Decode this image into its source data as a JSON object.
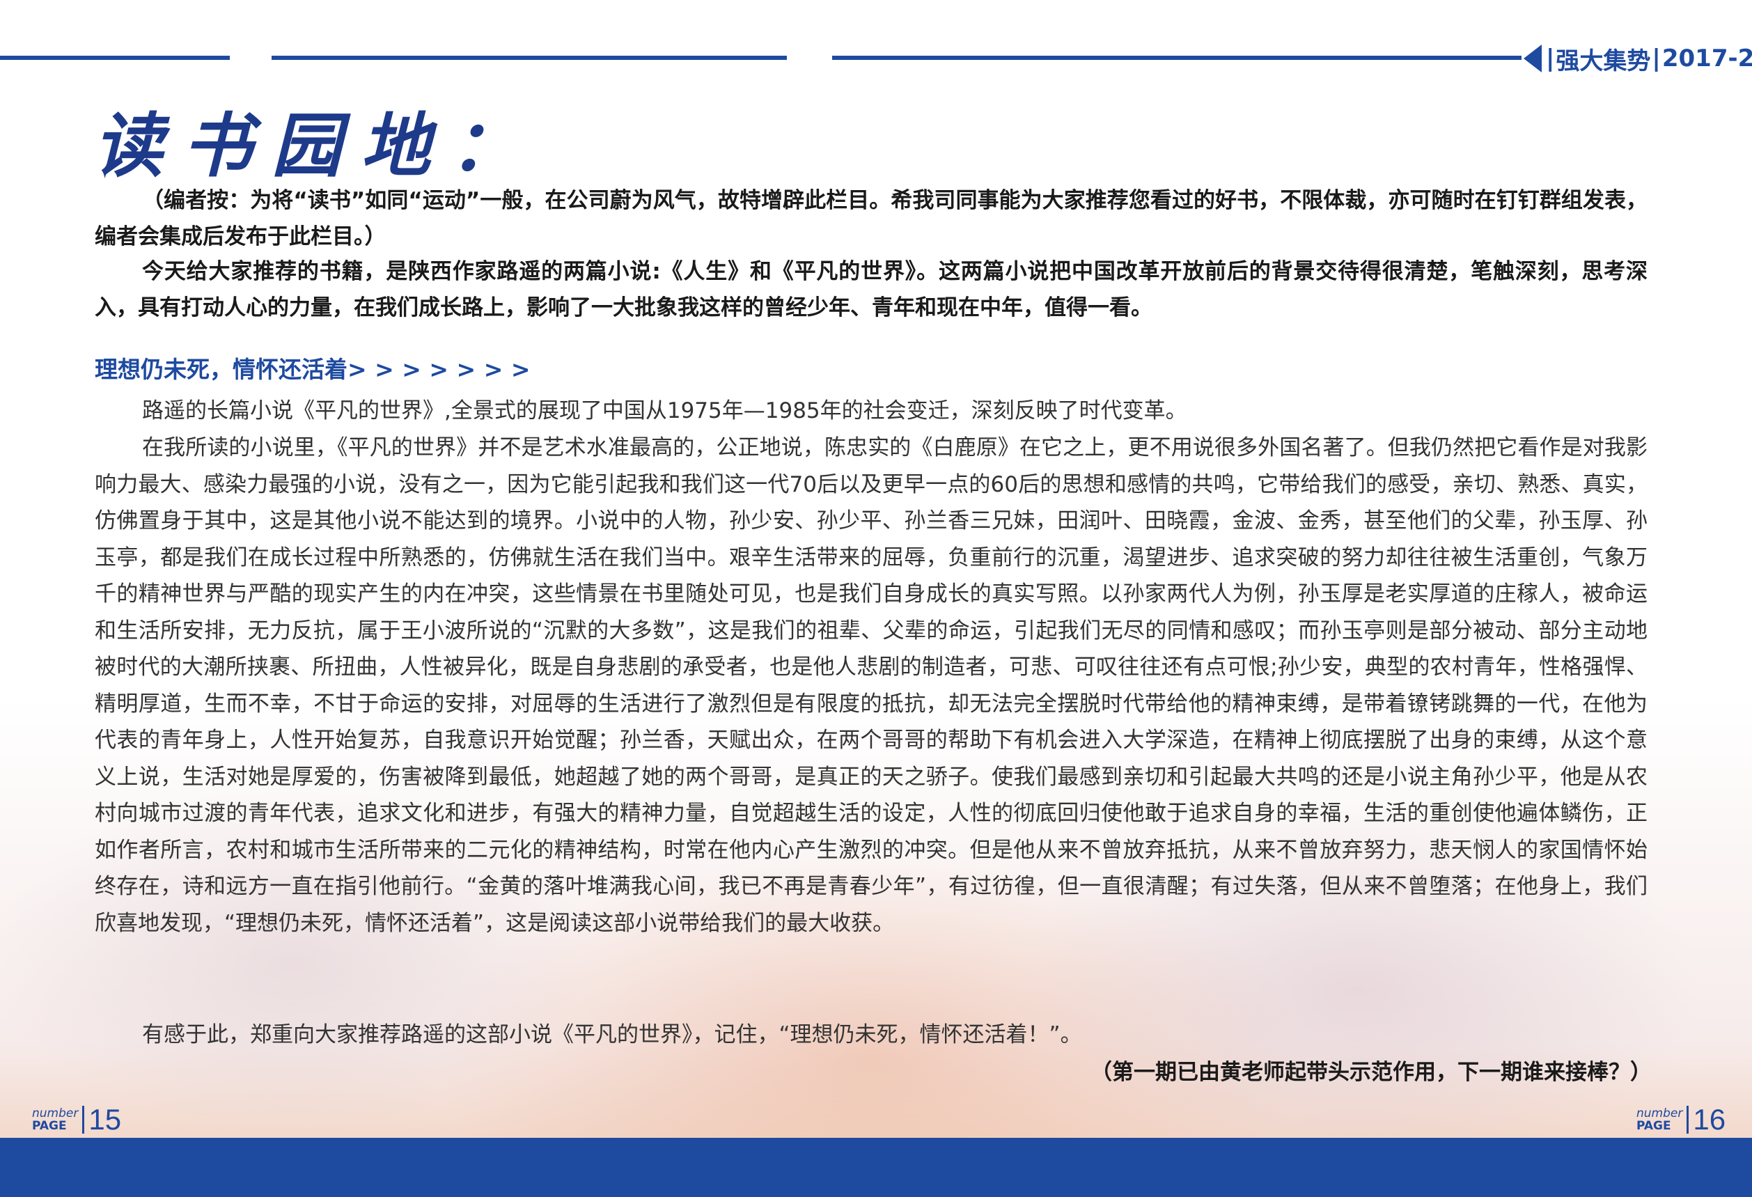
{
  "header": {
    "magazine": "强大集势",
    "issue": "2017-2"
  },
  "page_title": "读书园地：",
  "intro": {
    "editor_note": "（编者按：为将“读书”如同“运动”一般，在公司蔚为风气，故特增辟此栏目。希我司同事能为大家推荐您看过的好书，不限体裁，亦可随时在钉钉群组发表，编者会集成后发布于此栏目。）",
    "recommendation": "今天给大家推荐的书籍，是陕西作家路遥的两篇小说:《人生》和《平凡的世界》。这两篇小说把中国改革开放前后的背景交待得很清楚，笔触深刻，思考深入，具有打动人心的力量，在我们成长路上，影响了一大批象我这样的曾经少年、青年和现在中年，值得一看。"
  },
  "section": {
    "heading": "理想仍未死，情怀还活着> > > > > > >",
    "paragraphs": [
      "路遥的长篇小说《平凡的世界》,全景式的展现了中国从1975年—1985年的社会变迁，深刻反映了时代变革。",
      "在我所读的小说里，《平凡的世界》并不是艺术水准最高的，公正地说，陈忠实的《白鹿原》在它之上，更不用说很多外国名著了。但我仍然把它看作是对我影响力最大、感染力最强的小说，没有之一，因为它能引起我和我们这一代70后以及更早一点的60后的思想和感情的共鸣，它带给我们的感受，亲切、熟悉、真实，仿佛置身于其中，这是其他小说不能达到的境界。小说中的人物，孙少安、孙少平、孙兰香三兄妹，田润叶、田晓霞，金波、金秀，甚至他们的父辈，孙玉厚、孙玉亭，都是我们在成长过程中所熟悉的，仿佛就生活在我们当中。艰辛生活带来的屈辱，负重前行的沉重，渴望进步、追求突破的努力却往往被生活重创，气象万千的精神世界与严酷的现实产生的内在冲突，这些情景在书里随处可见，也是我们自身成长的真实写照。以孙家两代人为例，孙玉厚是老实厚道的庄稼人，被命运和生活所安排，无力反抗，属于王小波所说的“沉默的大多数”，这是我们的祖辈、父辈的命运，引起我们无尽的同情和感叹；而孙玉亭则是部分被动、部分主动地被时代的大潮所挟裹、所扭曲，人性被异化，既是自身悲剧的承受者，也是他人悲剧的制造者，可悲、可叹往往还有点可恨;孙少安，典型的农村青年，性格强悍、精明厚道，生而不幸，不甘于命运的安排，对屈辱的生活进行了激烈但是有限度的抵抗，却无法完全摆脱时代带给他的精神束缚，是带着镣铐跳舞的一代，在他为代表的青年身上，人性开始复苏，自我意识开始觉醒；孙兰香，天赋出众，在两个哥哥的帮助下有机会进入大学深造，在精神上彻底摆脱了出身的束缚，从这个意义上说，生活对她是厚爱的，伤害被降到最低，她超越了她的两个哥哥，是真正的天之骄子。使我们最感到亲切和引起最大共鸣的还是小说主角孙少平，他是从农村向城市过渡的青年代表，追求文化和进步，有强大的精神力量，自觉超越生活的设定，人性的彻底回归使他敢于追求自身的幸福，生活的重创使他遍体鳞伤，正如作者所言，农村和城市生活所带来的二元化的精神结构，时常在他内心产生激烈的冲突。但是他从来不曾放弃抵抗，从来不曾放弃努力，悲天悯人的家国情怀始终存在，诗和远方一直在指引他前行。“金黄的落叶堆满我心间，我已不再是青春少年”，有过彷徨，但一直很清醒；有过失落，但从来不曾堕落；在他身上，我们欣喜地发现，“理想仍未死，情怀还活着”，这是阅读这部小说带给我们的最大收获。",
      "有感于此，郑重向大家推荐路遥的这部小说《平凡的世界》，记住，“理想仍未死，情怀还活着！”。"
    ],
    "closing_note": "（第一期已由黄老师起带头示范作用，下一期谁来接棒？）"
  },
  "page_numbers": {
    "label_top": "number",
    "label_bottom": "PAGE",
    "left": "15",
    "right": "16"
  },
  "colors": {
    "brand_blue": "#1e4aa0",
    "title_blue": "#1e3a8a"
  }
}
